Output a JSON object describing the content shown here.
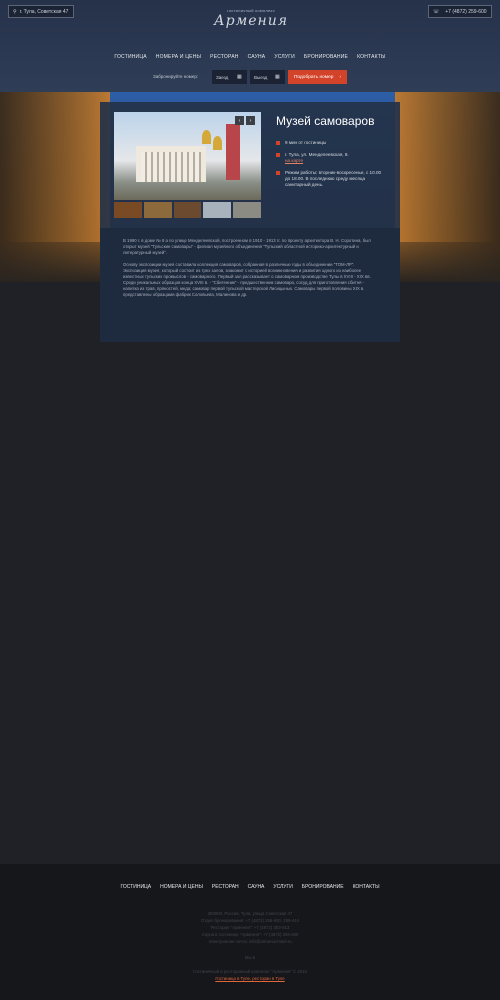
{
  "header": {
    "address": "г. Тула, Советская 47",
    "phone": "+7 (4872) 259-600",
    "logo_top": "гостиничный комплекс",
    "logo_name": "Армения"
  },
  "nav": [
    "ГОСТИНИЦА",
    "НОМЕРА И ЦЕНЫ",
    "РЕСТОРАН",
    "САУНА",
    "УСЛУГИ",
    "БРОНИРОВАНИЕ",
    "КОНТАКТЫ"
  ],
  "booking": {
    "label": "Забронируйте номер:",
    "checkin": "Заезд",
    "checkout": "Выезд",
    "button": "Подобрать номер",
    "arrow": "›"
  },
  "museum": {
    "title": "Музей самоваров",
    "distance": "9 мин от гостиницы",
    "address": "г. Тула, ул. Менделеевская, 8.",
    "map_link": "на карте",
    "hours": "Режим работы: вторник-воскресенье, с 10.00 до 18.00. В последнюю среду месяца санитарный день.",
    "text1": "В 1990 г. в доме № 8 а по улице Менделеевской, построенном в 1910 - 1913 гг. по проекту архитектора В. Н. Соротина, был открыт музей \"Тульские самовары\" - филиал музейного объединения \"Тульский областной историко-архитектурный и литературный музей\".",
    "text2": "Основу экспозиции музея составила коллекция самоваров, собранная в различные годы в объединении \"ТОМ-ЛР\". Экспозиция музея, который состоит из трех залов, знакомит с историей возникновения и развития одного из наиболее известных тульских промыслов - самоварного. Первый зал рассказывает о самоварном производстве Тулы в XVIII - XIX вв. Среди уникальных образцов конца XVIII в. - \"Сбитенник\" - предшественник самовара, сосуд для приготовления сбитня - напитка из трав, пряностей, меда; самовар первой тульской мастерской Лисицыных. Самовары первой половины XIX в. представлены образцами фабрик Соловьева, Малинова и др."
  },
  "footer": {
    "nav": [
      "ГОСТИНИЦА",
      "НОМЕРА И ЦЕНЫ",
      "РЕСТОРАН",
      "САУНА",
      "УСЛУГИ",
      "БРОНИРОВАНИЕ",
      "КОНТАКТЫ"
    ],
    "contacts": [
      "300000, Россия, Тула, улица Советская 47",
      "Отдел бронирования: +7 (4872) 259-600, 259-444",
      "Ресторан \"Армения\": +7 (4872) 303-013",
      "Сауна в гостинице \"Армения\": +7 (4872) 259-400",
      "Электронная почта: info@armenia-hotel.ru"
    ],
    "social": "Мы в",
    "copyright": "Гостиничный и ресторанный комплекс \"Армения\" © 2016",
    "link": "Гостиница в Туле, ресторан в Туле"
  },
  "colors": {
    "accent": "#d2432a",
    "header_bg": "#2b3850",
    "card_bg": "#243248",
    "page_bg": "#1f2126"
  }
}
